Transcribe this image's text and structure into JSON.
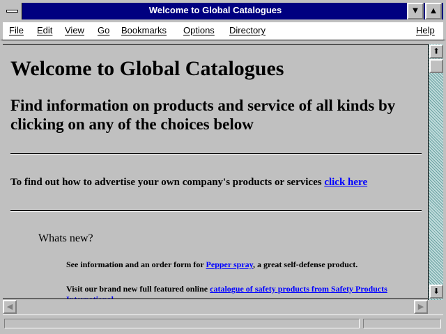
{
  "window": {
    "title": "Welcome to Global Catalogues"
  },
  "menu": {
    "items": [
      "File",
      "Edit",
      "View",
      "Go",
      "Bookmarks",
      "Options",
      "Directory"
    ],
    "help": "Help"
  },
  "page": {
    "heading": "Welcome to Global Catalogues",
    "subheading": "Find information on products and service of all kinds by clicking on any of the choices below",
    "advertise_text": "To find out how to advertise your own company's products or services ",
    "advertise_link": "click here",
    "whats_new": "Whats new?",
    "pepper_prefix": "See information and an order form for ",
    "pepper_link": "Pepper spray",
    "pepper_suffix": ", a great self-defense product.",
    "safety_prefix": "Visit our brand new full featured online ",
    "safety_link": "catalogue of safety products from Safety Products International"
  },
  "icons": {
    "minimize": "minimize-icon",
    "maximize": "maximize-icon",
    "scroll_up": "arrow-up-icon",
    "scroll_down": "arrow-down-icon",
    "scroll_left": "arrow-left-icon",
    "scroll_right": "arrow-right-icon"
  },
  "colors": {
    "title_bar": "#000080",
    "link": "#0000ff",
    "page_background": "#c0c0c0",
    "scroll_track": "#80b0b0"
  }
}
